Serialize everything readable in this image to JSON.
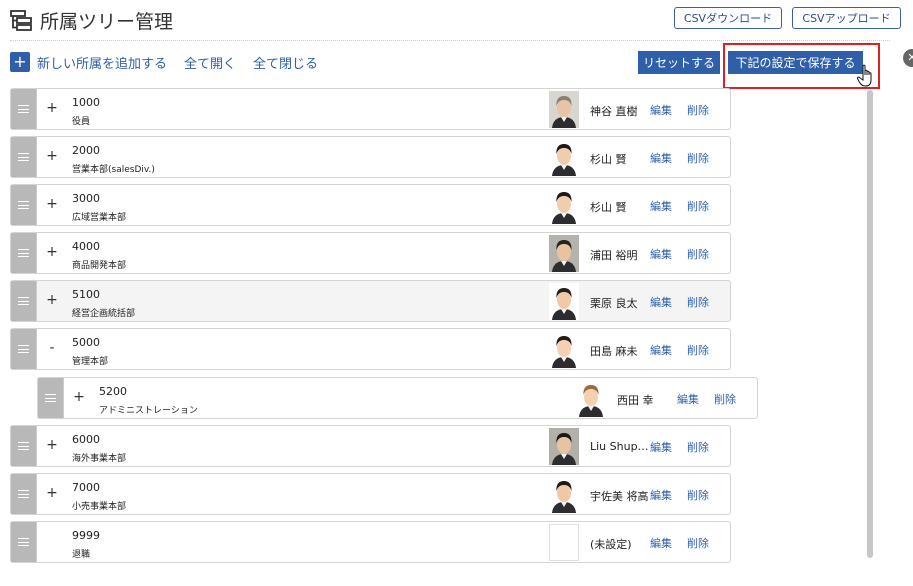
{
  "header": {
    "title": "所属ツリー管理",
    "csv_download": "CSVダウンロード",
    "csv_upload": "CSVアップロード"
  },
  "toolbar": {
    "add_label": "新しい所属を追加する",
    "expand_all": "全て開く",
    "collapse_all": "全て閉じる",
    "reset": "リセットする",
    "save": "下記の設定で保存する"
  },
  "actions": {
    "edit": "編集",
    "delete": "削除"
  },
  "rows": [
    {
      "code": "1000",
      "name": "役員",
      "manager": "神谷 直樹",
      "toggle": "+",
      "level": 0
    },
    {
      "code": "2000",
      "name": "営業本部(salesDiv.)",
      "manager": "杉山 賢",
      "toggle": "+",
      "level": 0
    },
    {
      "code": "3000",
      "name": "広域営業本部",
      "manager": "杉山 賢",
      "toggle": "+",
      "level": 0
    },
    {
      "code": "4000",
      "name": "商品開発本部",
      "manager": "浦田 裕明",
      "toggle": "+",
      "level": 0
    },
    {
      "code": "5100",
      "name": "経営企画統括部",
      "manager": "栗原 良太",
      "toggle": "+",
      "level": 0
    },
    {
      "code": "5000",
      "name": "管理本部",
      "manager": "田島 麻未",
      "toggle": "-",
      "level": 0
    },
    {
      "code": "5200",
      "name": "アドミニストレーション",
      "manager": "西田 幸",
      "toggle": "+",
      "level": 1
    },
    {
      "code": "6000",
      "name": "海外事業本部",
      "manager": "Liu Shup…",
      "toggle": "+",
      "level": 0
    },
    {
      "code": "7000",
      "name": "小売事業本部",
      "manager": "宇佐美 将高",
      "toggle": "+",
      "level": 0
    },
    {
      "code": "9999",
      "name": "退職",
      "manager": "(未設定)",
      "toggle": "",
      "level": 0
    }
  ]
}
